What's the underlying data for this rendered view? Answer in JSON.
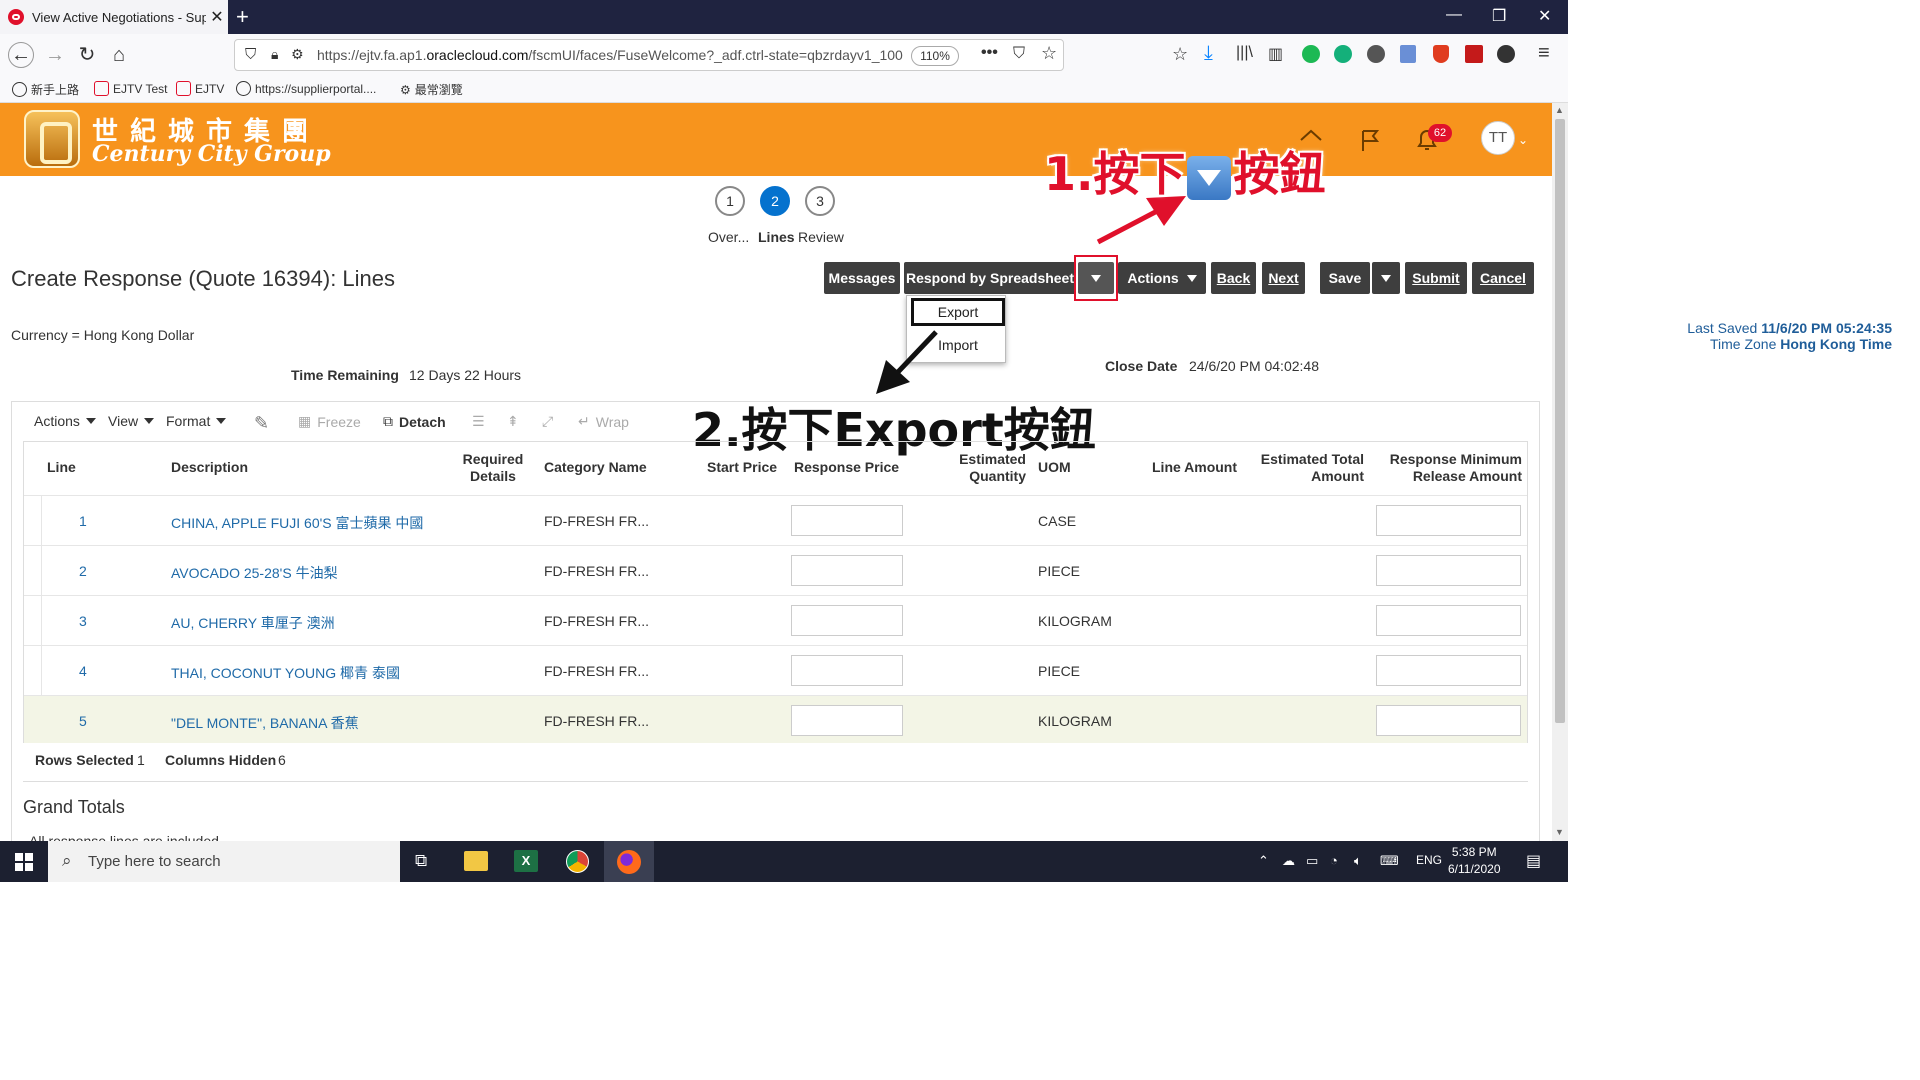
{
  "browser": {
    "tab_title": "View Active Negotiations - Sup",
    "url_prefix": "https://ejtv.fa.ap1.",
    "url_domain": "oraclecloud.com",
    "url_rest": "/fscmUI/faces/FuseWelcome?_adf.ctrl-state=qbzrdayv1_100",
    "zoom": "110%",
    "bookmarks": [
      "新手上路",
      "EJTV Test",
      "EJTV",
      "https://supplierportal....",
      "最常瀏覽"
    ]
  },
  "header": {
    "brand_cn": "世紀城市集團",
    "brand_en": "Century City Group",
    "notification_count": "62",
    "avatar": "TT"
  },
  "train": {
    "stops": [
      {
        "num": "1",
        "label": "Over..."
      },
      {
        "num": "2",
        "label": "Lines"
      },
      {
        "num": "3",
        "label": "Review"
      }
    ]
  },
  "page": {
    "title": "Create Response (Quote 16394): Lines",
    "currency": "Currency = Hong Kong Dollar",
    "time_remaining_label": "Time Remaining",
    "time_remaining_value": "12 Days 22 Hours",
    "close_date_label": "Close Date",
    "close_date_value": "24/6/20 PM 04:02:48",
    "last_saved_label": "Last Saved",
    "last_saved_value": "11/6/20 PM 05:24:35",
    "time_zone_label": "Time Zone",
    "time_zone_value": "Hong Kong Time"
  },
  "toolbar_buttons": {
    "messages": "Messages",
    "respond_by_spreadsheet": "Respond by Spreadsheet",
    "actions": "Actions",
    "back": "Back",
    "next": "Next",
    "save": "Save",
    "submit": "Submit",
    "cancel": "Cancel"
  },
  "dropdown_menu": [
    "Export",
    "Import"
  ],
  "annotations": {
    "step1_prefix": "1.按下",
    "step1_suffix": "按鈕",
    "step2": "2.按下Export按鈕"
  },
  "table_toolbar": {
    "actions": "Actions",
    "view": "View",
    "format": "Format",
    "freeze": "Freeze",
    "detach": "Detach",
    "wrap": "Wrap"
  },
  "table": {
    "headers": {
      "line": "Line",
      "description": "Description",
      "required_details": "Required Details",
      "category_name": "Category Name",
      "start_price": "Start Price",
      "response_price": "Response Price",
      "estimated_quantity": "Estimated Quantity",
      "uom": "UOM",
      "line_amount": "Line Amount",
      "estimated_total_amount": "Estimated Total Amount",
      "response_minimum_release_amount": "Response Minimum Release Amount"
    },
    "rows": [
      {
        "line": "1",
        "description": "CHINA, APPLE FUJI 60'S 富士蘋果 中國",
        "category": "FD-FRESH FR...",
        "uom": "CASE"
      },
      {
        "line": "2",
        "description": "AVOCADO 25-28'S 牛油梨",
        "category": "FD-FRESH FR...",
        "uom": "PIECE"
      },
      {
        "line": "3",
        "description": "AU, CHERRY 車厘子 澳洲",
        "category": "FD-FRESH FR...",
        "uom": "KILOGRAM"
      },
      {
        "line": "4",
        "description": "THAI, COCONUT YOUNG 椰青 泰國",
        "category": "FD-FRESH FR...",
        "uom": "PIECE"
      },
      {
        "line": "5",
        "description": "\"DEL MONTE\", BANANA 香蕉",
        "category": "FD-FRESH FR...",
        "uom": "KILOGRAM"
      }
    ],
    "rows_selected_label": "Rows Selected",
    "rows_selected_value": "1",
    "columns_hidden_label": "Columns Hidden",
    "columns_hidden_value": "6"
  },
  "grand_totals": {
    "title": "Grand Totals",
    "note": "All response lines are included"
  },
  "taskbar": {
    "search_placeholder": "Type here to search",
    "language": "ENG",
    "time": "5:38 PM",
    "date": "6/11/2020"
  }
}
